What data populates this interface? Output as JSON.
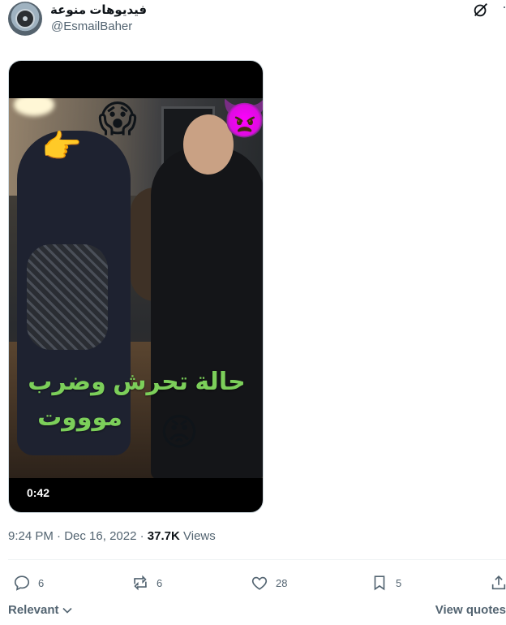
{
  "tweet": {
    "display_name": "فيديوهات منوعة",
    "handle": "@EsmailBaher",
    "icons": {
      "grok": "grok-icon",
      "more": "more-icon"
    }
  },
  "media": {
    "overlay_line1": "حالة تحرش وضرب",
    "overlay_line2": "موووت",
    "duration": "0:42",
    "emojis": {
      "pointing": "👉",
      "scream": "😱",
      "devil": "👿",
      "angry": "😡"
    }
  },
  "meta": {
    "time": "9:24 PM",
    "date": "Dec 16, 2022",
    "views_count": "37.7K",
    "views_label": "Views",
    "separator": "·"
  },
  "actions": {
    "replies": "6",
    "reposts": "6",
    "likes": "28",
    "bookmarks": "5"
  },
  "footer": {
    "sort_label": "Relevant",
    "view_quotes": "View quotes"
  },
  "colors": {
    "text": "#0f1419",
    "muted": "#536471",
    "overlay_text": "#7ccf5a"
  }
}
